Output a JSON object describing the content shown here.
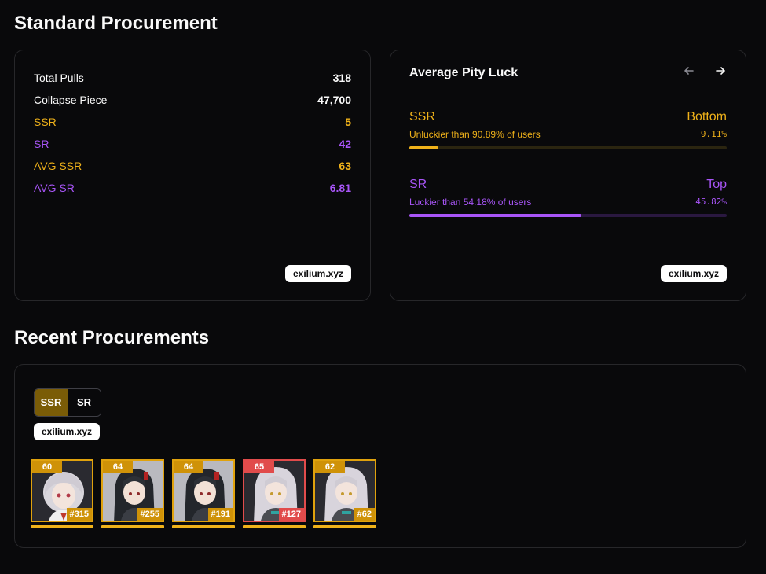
{
  "sections": {
    "standard_title": "Standard Procurement",
    "recent_title": "Recent Procurements"
  },
  "stats": {
    "rows": [
      {
        "label": "Total Pulls",
        "value": "318",
        "tone": "white"
      },
      {
        "label": "Collapse Piece",
        "value": "47,700",
        "tone": "white"
      },
      {
        "label": "SSR",
        "value": "5",
        "tone": "gold"
      },
      {
        "label": "SR",
        "value": "42",
        "tone": "purple"
      },
      {
        "label": "AVG SSR",
        "value": "63",
        "tone": "gold"
      },
      {
        "label": "AVG SR",
        "value": "6.81",
        "tone": "purple"
      }
    ],
    "watermark": "exilium.xyz"
  },
  "luck": {
    "title": "Average Pity Luck",
    "prev_icon": "arrow-left-icon",
    "next_icon": "arrow-right-icon",
    "items": [
      {
        "name": "SSR",
        "rank": "Bottom",
        "desc": "Unluckier than 90.89% of users",
        "pct": "9.11%",
        "fill": 0.0911,
        "color": "#f0b21a",
        "track": "#2b2510"
      },
      {
        "name": "SR",
        "rank": "Top",
        "desc": "Luckier than 54.18% of users",
        "pct": "45.82%",
        "fill": 0.5418,
        "color": "#a855f7",
        "track": "#2a1840"
      }
    ],
    "watermark": "exilium.xyz"
  },
  "recent": {
    "tabs": [
      {
        "label": "SSR",
        "active": true
      },
      {
        "label": "SR",
        "active": false
      }
    ],
    "watermark": "exilium.xyz",
    "characters": [
      {
        "pity": "60",
        "pull": "#315",
        "border": "gold"
      },
      {
        "pity": "64",
        "pull": "#255",
        "border": "gold"
      },
      {
        "pity": "64",
        "pull": "#191",
        "border": "gold"
      },
      {
        "pity": "65",
        "pull": "#127",
        "border": "red"
      },
      {
        "pity": "62",
        "pull": "#62",
        "border": "gold"
      }
    ]
  },
  "colors": {
    "gold": "#f0b21a",
    "purple": "#a855f7",
    "red": "#e14b4b",
    "bg": "#09090b"
  }
}
